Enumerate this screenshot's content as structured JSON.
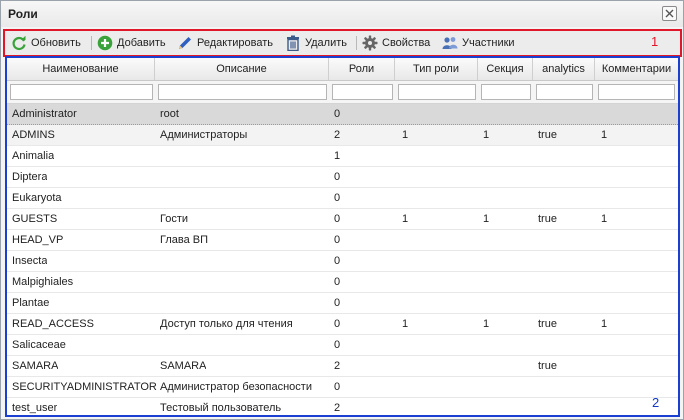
{
  "window": {
    "title": "Роли"
  },
  "toolbar": {
    "refresh_label": "Обновить",
    "add_label": "Добавить",
    "edit_label": "Редактировать",
    "delete_label": "Удалить",
    "properties_label": "Свойства",
    "members_label": "Участники",
    "marker": "1"
  },
  "grid": {
    "marker": "2",
    "columns": [
      "Наименование",
      "Описание",
      "Роли",
      "Тип роли",
      "Секция",
      "analytics",
      "Комментарии"
    ],
    "rows": [
      [
        "Administrator",
        "root",
        "0",
        "",
        "",
        "",
        ""
      ],
      [
        "ADMINS",
        "Администраторы",
        "2",
        "1",
        "1",
        "true",
        "1"
      ],
      [
        "Animalia",
        "",
        "1",
        "",
        "",
        "",
        ""
      ],
      [
        "Diptera",
        "",
        "0",
        "",
        "",
        "",
        ""
      ],
      [
        "Eukaryota",
        "",
        "0",
        "",
        "",
        "",
        ""
      ],
      [
        "GUESTS",
        "Гости",
        "0",
        "1",
        "1",
        "true",
        "1"
      ],
      [
        "HEAD_VP",
        "Глава ВП",
        "0",
        "",
        "",
        "",
        ""
      ],
      [
        "Insecta",
        "",
        "0",
        "",
        "",
        "",
        ""
      ],
      [
        "Malpighiales",
        "",
        "0",
        "",
        "",
        "",
        ""
      ],
      [
        "Plantae",
        "",
        "0",
        "",
        "",
        "",
        ""
      ],
      [
        "READ_ACCESS",
        "Доступ только для чтения",
        "0",
        "1",
        "1",
        "true",
        "1"
      ],
      [
        "Salicaceae",
        "",
        "0",
        "",
        "",
        "",
        ""
      ],
      [
        "SAMARA",
        "SAMARA",
        "2",
        "",
        "",
        "true",
        ""
      ],
      [
        "SECURITYADMINISTRATOR",
        "Администратор безопасности",
        "0",
        "",
        "",
        "",
        ""
      ],
      [
        "test_user",
        "Тестовый пользователь",
        "2",
        "",
        "",
        "",
        ""
      ]
    ]
  },
  "colors": {
    "toolbar_highlight": "#e0162b",
    "grid_highlight": "#1b3fd1"
  }
}
